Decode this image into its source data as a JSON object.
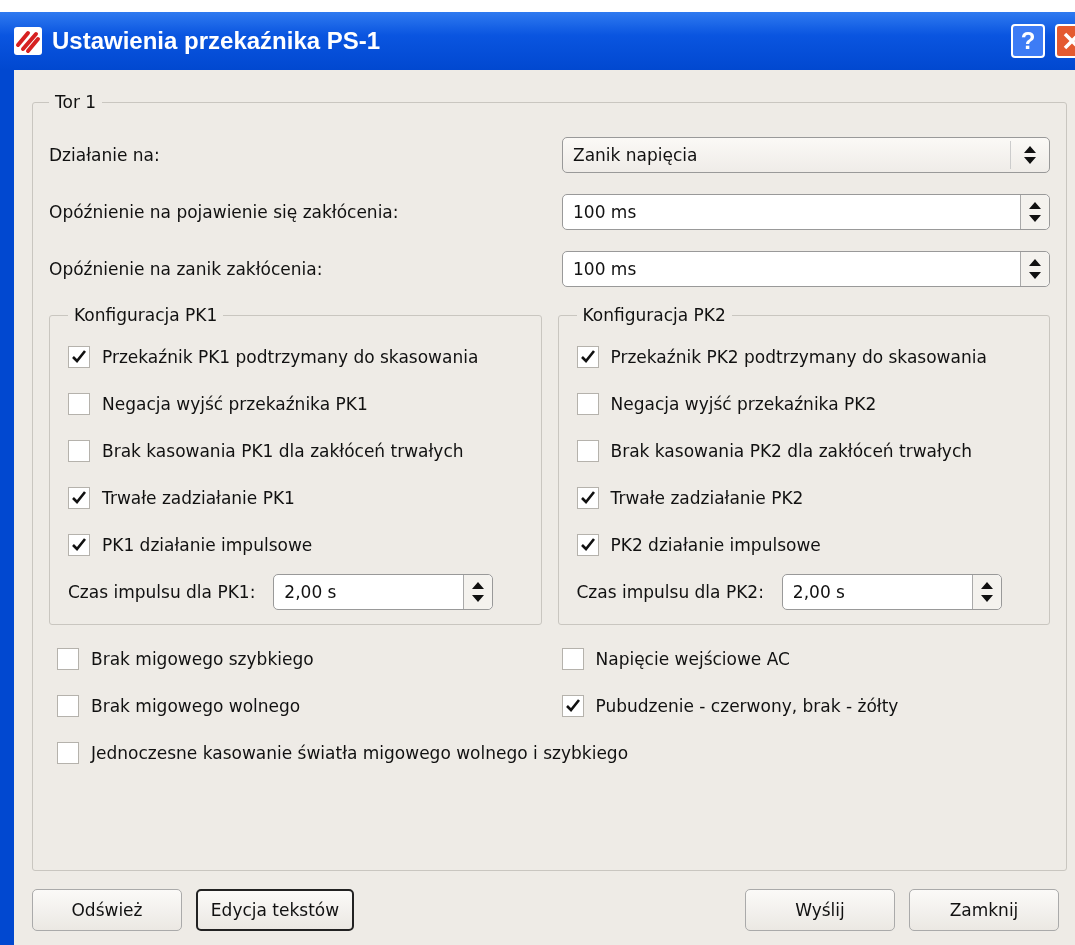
{
  "window": {
    "title": "Ustawienia przekaźnika PS-1",
    "help_button": "?"
  },
  "group": {
    "title": "Tor 1"
  },
  "fields": [
    {
      "label": "Działanie na:",
      "kind": "select",
      "value": "Zanik napięcia"
    },
    {
      "label": "Opóźnienie na pojawienie się zakłócenia:",
      "kind": "spin",
      "value": "100 ms"
    },
    {
      "label": "Opóźnienie na zanik zakłócenia:",
      "kind": "spin",
      "value": "100 ms"
    }
  ],
  "relay_groups": [
    {
      "title": "Konfiguracja PK1",
      "options": [
        {
          "label": "Przekaźnik PK1 podtrzymany do skasowania",
          "checked": true
        },
        {
          "label": "Negacja wyjść przekaźnika PK1",
          "checked": false
        },
        {
          "label": "Brak kasowania PK1 dla zakłóceń trwałych",
          "checked": false
        },
        {
          "label": "Trwałe zadziałanie PK1",
          "checked": true
        },
        {
          "label": "PK1 działanie impulsowe",
          "checked": true
        }
      ],
      "pulse_time": {
        "label": "Czas impulsu dla PK1:",
        "value": "2,00 s"
      }
    },
    {
      "title": "Konfiguracja PK2",
      "options": [
        {
          "label": "Przekaźnik PK2 podtrzymany do skasowania",
          "checked": true
        },
        {
          "label": "Negacja wyjść przekaźnika PK2",
          "checked": false
        },
        {
          "label": "Brak kasowania PK2 dla zakłóceń trwałych",
          "checked": false
        },
        {
          "label": "Trwałe zadziałanie PK2",
          "checked": true
        },
        {
          "label": "PK2 działanie impulsowe",
          "checked": true
        }
      ],
      "pulse_time": {
        "label": "Czas impulsu dla PK2:",
        "value": "2,00 s"
      }
    }
  ],
  "option_rows": [
    [
      {
        "label": "Brak migowego szybkiego",
        "checked": false
      },
      {
        "label": "Napięcie wejściowe AC",
        "checked": false
      }
    ],
    [
      {
        "label": "Brak migowego wolnego",
        "checked": false
      },
      {
        "label": "Pubudzenie - czerwony, brak - żółty",
        "checked": true
      }
    ],
    [
      {
        "label": "Jednoczesne kasowanie światła migowego wolnego i szybkiego",
        "checked": false
      }
    ]
  ],
  "buttons_left": [
    {
      "label": "Odśwież",
      "focused": false
    },
    {
      "label": "Edycja tekstów",
      "focused": true
    }
  ],
  "buttons_right": [
    {
      "label": "Wyślij",
      "focused": false
    },
    {
      "label": "Zamknij",
      "focused": false
    }
  ]
}
